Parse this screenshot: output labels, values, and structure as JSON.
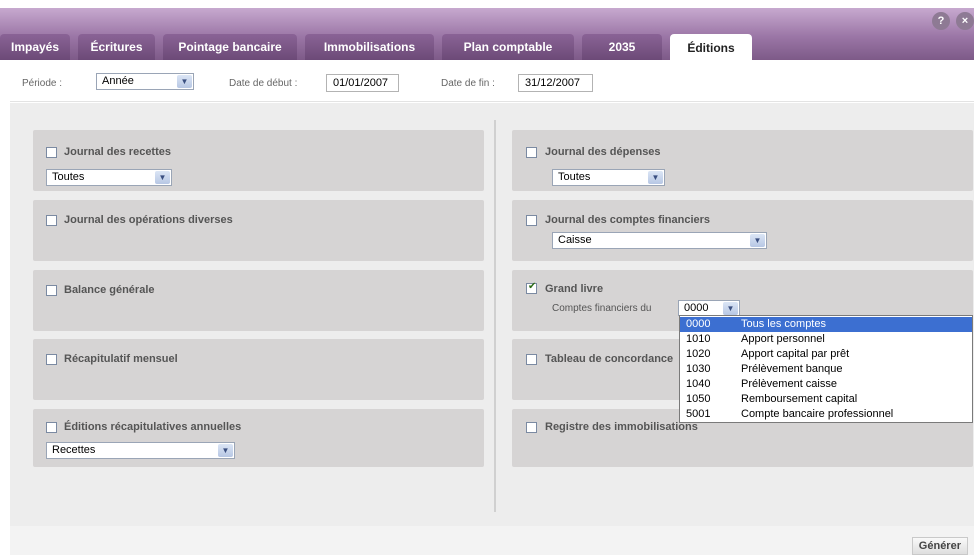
{
  "tabs": [
    {
      "label": "Impayés"
    },
    {
      "label": "Écritures"
    },
    {
      "label": "Pointage bancaire"
    },
    {
      "label": "Immobilisations"
    },
    {
      "label": "Plan comptable"
    },
    {
      "label": "2035"
    },
    {
      "label": "Éditions",
      "active": true
    }
  ],
  "top_icons": {
    "help": "?",
    "close": "×"
  },
  "period": {
    "label": "Période :",
    "value": "Année",
    "start_label": "Date de début :",
    "start_value": "01/01/2007",
    "end_label": "Date de fin :",
    "end_value": "31/12/2007"
  },
  "left_panels": [
    {
      "title": "Journal des recettes",
      "checked": false,
      "select": "Toutes"
    },
    {
      "title": "Journal des opérations diverses",
      "checked": false
    },
    {
      "title": "Balance générale",
      "checked": false
    },
    {
      "title": "Récapitulatif mensuel",
      "checked": false
    },
    {
      "title": "Éditions récapitulatives annuelles",
      "checked": false,
      "select": "Recettes"
    }
  ],
  "right_panels": [
    {
      "title": "Journal des dépenses",
      "checked": false,
      "select": "Toutes"
    },
    {
      "title": "Journal des comptes financiers",
      "checked": false,
      "select": "Caisse"
    },
    {
      "title": "Grand livre",
      "checked": true,
      "sub_label": "Comptes financiers du",
      "select": "0000"
    },
    {
      "title": "Tableau de concordance",
      "checked": false
    },
    {
      "title": "Registre des immobilisations",
      "checked": false
    }
  ],
  "dropdown": {
    "selected_index": 0,
    "options": [
      {
        "code": "0000",
        "name": "Tous les comptes"
      },
      {
        "code": "1010",
        "name": "Apport personnel"
      },
      {
        "code": "1020",
        "name": "Apport capital par prêt"
      },
      {
        "code": "1030",
        "name": "Prélèvement banque"
      },
      {
        "code": "1040",
        "name": "Prélèvement caisse"
      },
      {
        "code": "1050",
        "name": "Remboursement capital"
      },
      {
        "code": "5001",
        "name": "Compte bancaire professionnel"
      }
    ]
  },
  "footer": {
    "generate_label": "Générer"
  },
  "colors": {
    "brand_purple": "#8a6396",
    "selection_blue": "#3c6fd1",
    "panel_gray": "#d6d4d4"
  }
}
